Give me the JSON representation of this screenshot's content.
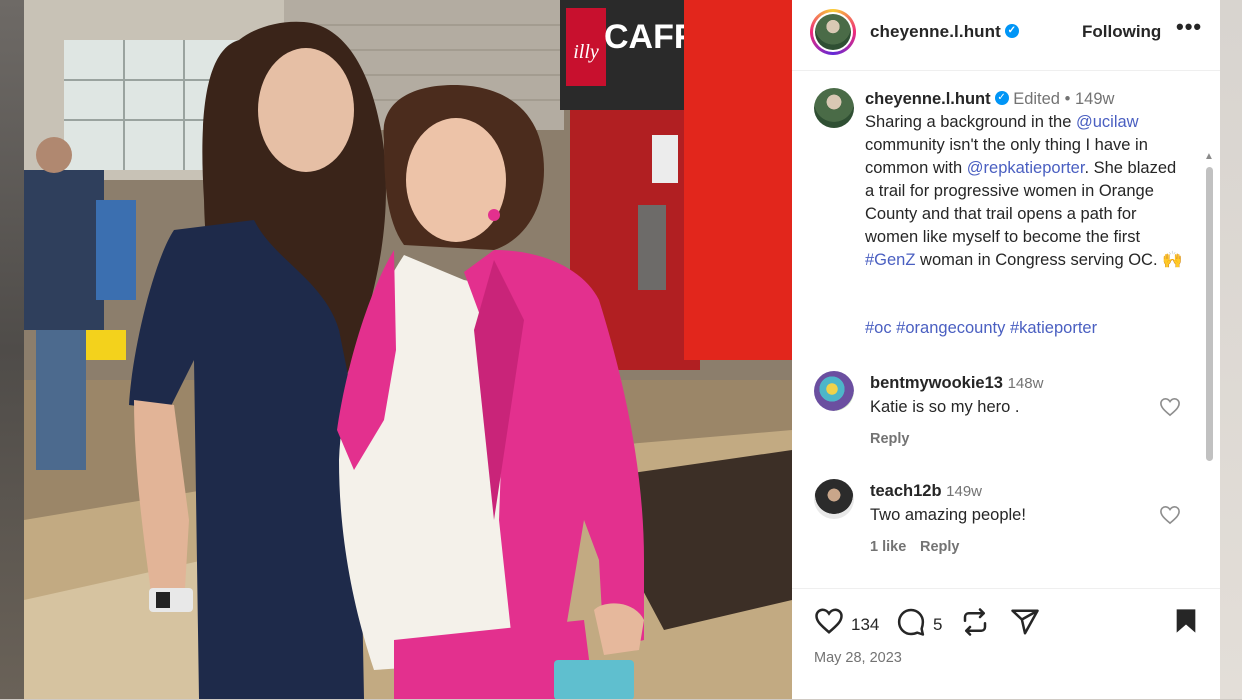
{
  "post": {
    "header": {
      "username": "cheyenne.l.hunt",
      "follow_label": "Following",
      "more_label": "•••"
    },
    "caption": {
      "username": "cheyenne.l.hunt",
      "edited": "Edited",
      "dot": "•",
      "age": "149w",
      "t1": "Sharing a background in the ",
      "m1": "@ucilaw",
      "t2": " community isn't the only thing I have in common with ",
      "m2": "@repkatieporter",
      "t3": ". She blazed a trail for progressive women in Orange County and that trail opens a path for women like myself to become the first ",
      "h1": "#GenZ",
      "t4": " woman in Congress serving OC. 🙌",
      "hashtags": "#oc #orangecounty #katieporter"
    },
    "comments": [
      {
        "username": "bentmywookie13",
        "age": "148w",
        "text": "Katie is so my hero .",
        "reply_label": "Reply",
        "likes": ""
      },
      {
        "username": "teach12b",
        "age": "149w",
        "text": "Two amazing people!",
        "reply_label": "Reply",
        "likes": "1 like"
      }
    ],
    "actions": {
      "likes_count": "134",
      "comments_count": "5"
    },
    "date": "May 28, 2023"
  },
  "photo": {
    "sign_text": "CAFFE",
    "logo_text": "illy"
  },
  "colors": {
    "accent_link": "#4a5fc1",
    "verified_blue": "#0095f6",
    "text": "#262626",
    "muted": "#737373",
    "blazer_pink": "#e3308e",
    "wall_red": "#d4241f"
  }
}
